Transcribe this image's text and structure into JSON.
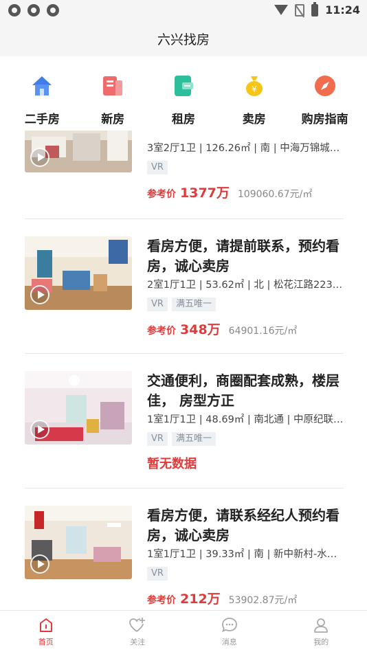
{
  "status_bar": {
    "time": "11:24"
  },
  "header": {
    "title": "六兴找房"
  },
  "categories": [
    {
      "label": "二手房",
      "icon": "house-icon",
      "color": "#3f7ee8"
    },
    {
      "label": "新房",
      "icon": "building-icon",
      "color": "#f06b6b"
    },
    {
      "label": "租房",
      "icon": "wallet-icon",
      "color": "#2dbf9b"
    },
    {
      "label": "卖房",
      "icon": "money-bag-icon",
      "color": "#f5c518"
    },
    {
      "label": "购房指南",
      "icon": "compass-icon",
      "color": "#f26d4f"
    }
  ],
  "listings": [
    {
      "title": "",
      "meta": "3室2厅1卫 | 126.26㎡ | 南 | 中海万锦城…",
      "tags": [
        "VR"
      ],
      "price_label": "参考价",
      "price": "1377万",
      "unit_price": "109060.67元/㎡"
    },
    {
      "title": "看房方便，请提前联系，预约看房，诚心卖房",
      "meta": "2室1厅1卫 | 53.62㎡ | 北 | 松花江路223…",
      "tags": [
        "VR",
        "满五唯一"
      ],
      "price_label": "参考价",
      "price": "348万",
      "unit_price": "64901.16元/㎡"
    },
    {
      "title": "交通便利，商圈配套成熟，楼层佳， 房型方正",
      "meta": "1室1厅1卫 | 48.69㎡ | 南北通 | 中原纪联…",
      "tags": [
        "VR",
        "满五唯一"
      ],
      "no_data": "暂无数据"
    },
    {
      "title": "看房方便，请联系经纪人预约看房，诚心卖房",
      "meta": "1室1厅1卫 | 39.33㎡ | 南 | 新中新村-水…",
      "tags": [
        "VR"
      ],
      "price_label": "参考价",
      "price": "212万",
      "unit_price": "53902.87元/㎡"
    }
  ],
  "tabbar": [
    {
      "label": "首页",
      "icon": "home-icon",
      "active": true
    },
    {
      "label": "关注",
      "icon": "heart-plus-icon",
      "active": false
    },
    {
      "label": "消息",
      "icon": "chat-bubble-icon",
      "active": false
    },
    {
      "label": "我的",
      "icon": "user-icon",
      "active": false
    }
  ],
  "colors": {
    "accent": "#e03b3b",
    "muted": "#888888"
  }
}
